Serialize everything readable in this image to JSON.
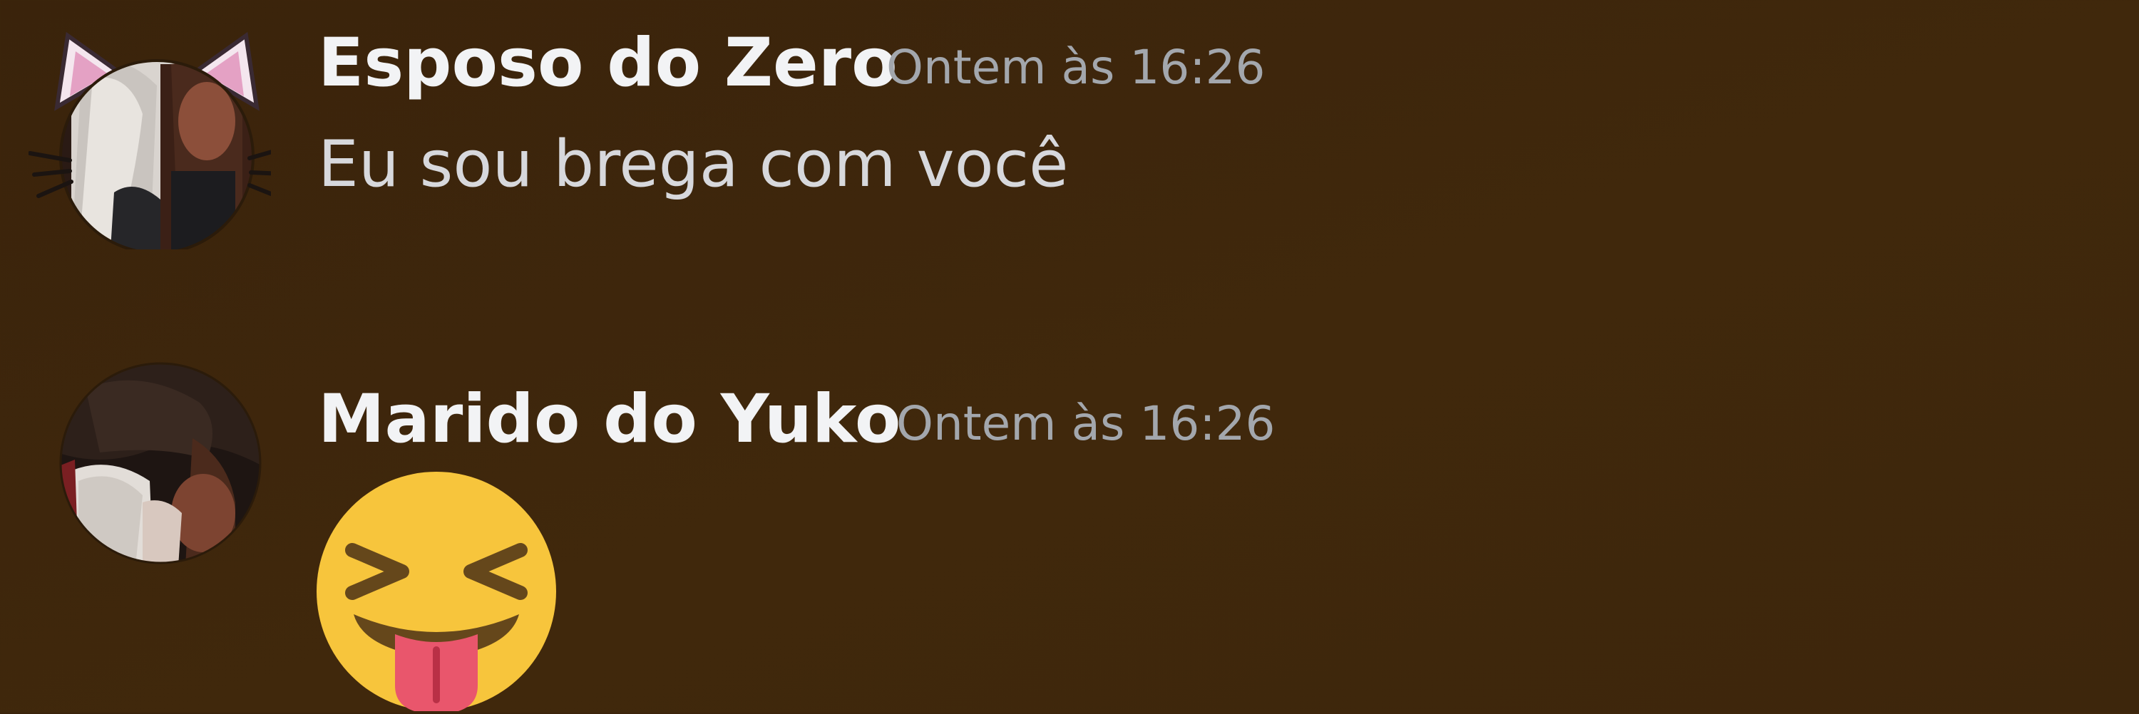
{
  "messages": [
    {
      "author": "Esposo do Zero",
      "timestamp": "Ontem às 16:26",
      "content": "Eu sou brega com você",
      "avatar": {
        "icon": "cat-ears-avatar",
        "decoration": "cat-ears-whiskers"
      }
    },
    {
      "author": "Marido do Yuko",
      "timestamp": "Ontem às 16:26",
      "emoji": {
        "icon": "squinting-face-with-tongue",
        "unicode": "😝"
      },
      "avatar": {
        "icon": "avatar"
      }
    }
  ],
  "colors": {
    "background": "#3d250b",
    "author": "#f2f3f5",
    "timestamp": "#a3a7ad",
    "content": "#d7d8dc",
    "emoji_face": "#f7c53c",
    "emoji_features": "#65471b",
    "emoji_tongue": "#e9566c"
  }
}
